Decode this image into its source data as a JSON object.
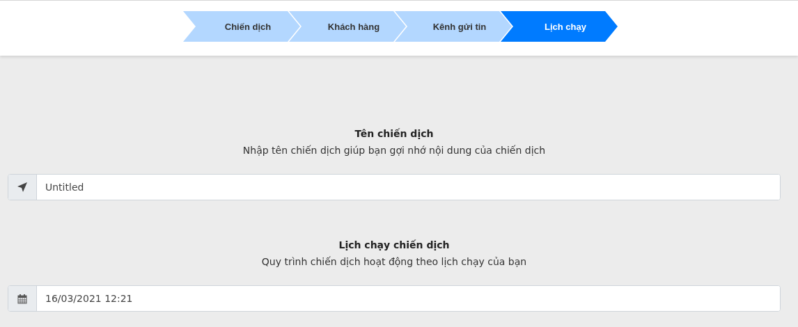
{
  "steps": [
    {
      "label": "Chiến dịch",
      "selected": false
    },
    {
      "label": "Khách hàng",
      "selected": false
    },
    {
      "label": "Kênh gửi tin",
      "selected": false
    },
    {
      "label": "Lịch chạy",
      "selected": true
    }
  ],
  "sections": [
    {
      "title": "Tên chiến dịch",
      "description": "Nhập tên chiến dịch giúp bạn gợi nhớ nội dung của chiến dịch",
      "field": {
        "kind": "text",
        "value": "Untitled"
      }
    },
    {
      "title": "Lịch chạy chiến dịch",
      "description": "Quy trình chiến dịch hoạt động theo lịch chạy của bạn",
      "field": {
        "kind": "datetime",
        "value": "16/03/2021 12:21"
      }
    }
  ]
}
